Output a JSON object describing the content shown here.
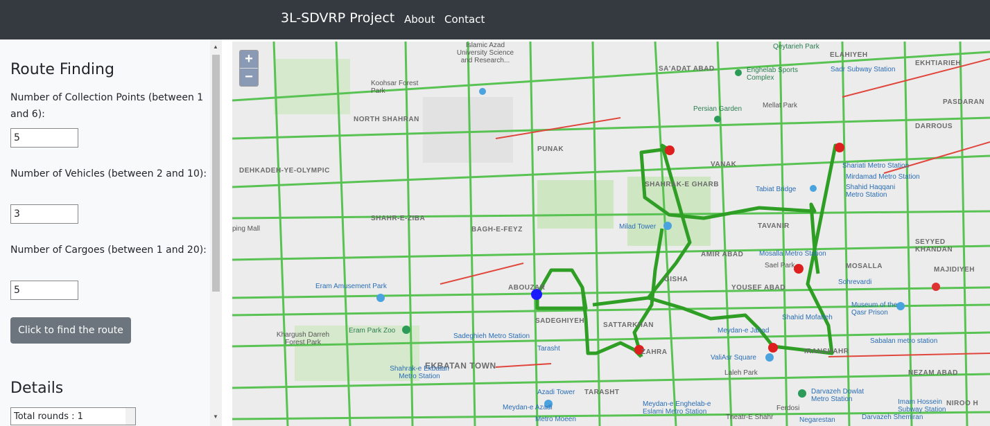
{
  "navbar": {
    "brand": "3L-SDVRP Project",
    "links": [
      "About",
      "Contact"
    ]
  },
  "sidebar": {
    "route_finding_title": "Route Finding",
    "collection_points_label": "Number of Collection Points (between 1 and 6):",
    "collection_points_value": "5",
    "vehicles_label": "Number of Vehicles (between 2 and 10):",
    "vehicles_value": "3",
    "cargoes_label": "Number of Cargoes (between 1 and 20):",
    "cargoes_value": "5",
    "find_button": "Click to find the route",
    "details_title": "Details",
    "details_text": "Total rounds : 1"
  },
  "map": {
    "zoom_in": "+",
    "zoom_out": "−",
    "labels": {
      "qeytarieh_park": "Qeytarieh Park",
      "elahiyeh": "ELAHIYEH",
      "sadr_subway": "Sadr Subway Station",
      "ekhtiarieh": "EKHTIARIEH",
      "islamic_azad": "Islamic Azad University Science and Research...",
      "koohsar": "Koohsar Forest Park",
      "saadat_abad": "SA'ADAT ABAD",
      "enghelab_sports": "Enghelab Sports Complex",
      "pasdaran": "PASDARAN",
      "north_shahran": "NORTH SHAHRAN",
      "persian_garden": "Persian Garden",
      "mellat_park": "Mellat Park",
      "darrous": "DARROUS",
      "dehkadeh": "DEHKADEH-YE-OLYMPIC",
      "punak": "PUNAK",
      "vanak": "VANAK",
      "shahrak_gharb": "SHAHRAK-E GHARB",
      "shariati_metro": "Shariati Metro Station",
      "mirdamad_metro": "Mirdamad Metro Station",
      "tabiat_bridge": "Tabiat Bridge",
      "shahid_haqqani": "Shahid Haqqani Metro Station",
      "shahr_e_ziba": "SHAHR-E-ZIBA",
      "bagh_e_feyz": "BAGH-E-FEYZ",
      "milad_tower": "Milad Tower",
      "tavanir": "TAVANIR",
      "seyyed_khandan": "SEYYED KHANDAN",
      "mall": "ping Mall",
      "amir_abad": "AMIR ABAD",
      "mosalla_metro": "Mosalla Metro Station",
      "sael_park": "Sael Park",
      "mosalla": "MOSALLA",
      "majidiyeh": "MAJIDIYEH",
      "eram_park": "Eram Amusement Park",
      "abouzar": "ABOUZAR",
      "gisha": "GISHA",
      "yousef_abad": "YOUSEF ABAD",
      "sohrevardi": "Sohrevardi",
      "museum_qasr": "Museum of the Qasr Prison",
      "sadeghiyeh": "SADEGHIYEH",
      "satarkhan": "SATTARKHAN",
      "shahid_mofatteh": "Shahid Mofatteh",
      "eram_zoo": "Eram Park Zoo",
      "khargush": "Khargush Darreh Forest Park",
      "sadeghieh_metro": "Sadeghieh Metro Station",
      "tarasht": "Tarasht",
      "meydan_jahad": "Meydan-e Jahad",
      "valiasr_square": "ValiAsr Square",
      "sabalan_metro": "Sabalan metro station",
      "ekbatan": "EKBATAN TOWN",
      "zahra": "ZAHRA",
      "iranshahr": "IRANSHAHR",
      "laleh_park": "Laleh Park",
      "nezam_abad": "NEZAM ABAD",
      "shahrak_ekbatan_metro": "Shahrak-e Ekbatan Metro Station",
      "azadi_tower": "Azadi Tower",
      "tarasht_caps": "TARASHT",
      "darvazeh_dowlat": "Darvazeh Dowlat Metro Station",
      "imam_hossein": "Imam Hossein Subway Station",
      "meydan_azadi": "Meydan-e Azadi",
      "meydan_enghelab": "Meydan-e Enghelab-e Eslami Metro Station",
      "ferdosi": "Ferdosi",
      "nirou": "NIROO H",
      "metro_moein": "Metro Moeen",
      "theater_shahr": "Theatr-E Shahr",
      "negarestan": "Negarestan",
      "darvazeh_shemiran": "Darvazeh Shemiran"
    }
  }
}
